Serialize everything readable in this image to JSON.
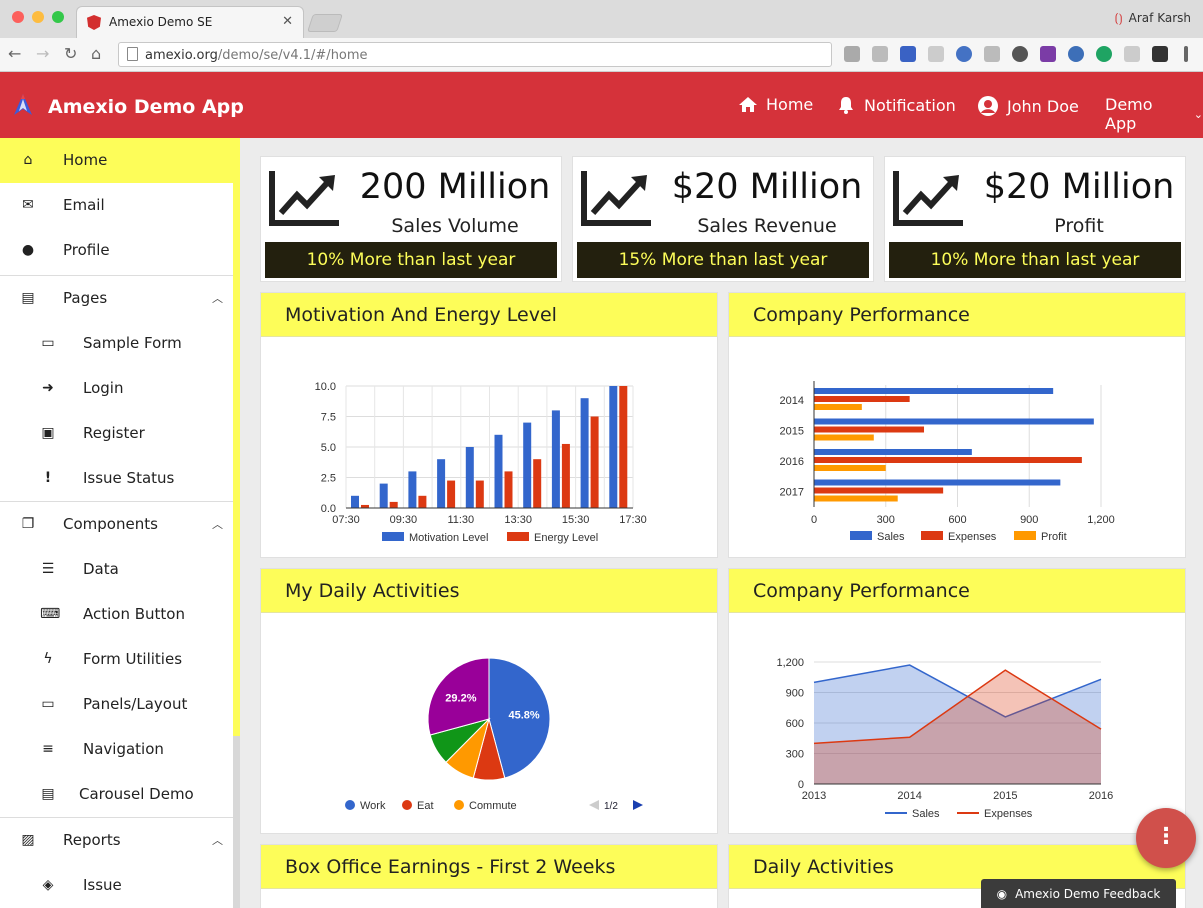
{
  "browser": {
    "tab_title": "Amexio Demo SE",
    "url_host": "amexio.org",
    "url_path": "/demo/se/v4.1/#/home",
    "user_name": "Araf Karsh"
  },
  "header": {
    "app_title": "Amexio Demo App",
    "nav": [
      {
        "label": "Home",
        "icon": "home-icon"
      },
      {
        "label": "Notification",
        "icon": "bell-icon"
      },
      {
        "label": "John Doe",
        "icon": "user-circle-icon"
      },
      {
        "label": "Demo App",
        "icon": "chevron-down-icon"
      }
    ]
  },
  "sidebar": {
    "items": [
      {
        "label": "Home",
        "icon": "home-icon",
        "active": true
      },
      {
        "label": "Email",
        "icon": "envelope-icon"
      },
      {
        "label": "Profile",
        "icon": "user-icon"
      },
      {
        "label": "Pages",
        "icon": "id-card-icon",
        "expanded": true
      },
      {
        "label": "Sample Form",
        "icon": "laptop-icon"
      },
      {
        "label": "Login",
        "icon": "sign-in-icon"
      },
      {
        "label": "Register",
        "icon": "address-book-icon"
      },
      {
        "label": "Issue Status",
        "icon": "exclamation-icon"
      },
      {
        "label": "Components",
        "icon": "clone-icon",
        "expanded": true
      },
      {
        "label": "Data",
        "icon": "database-icon"
      },
      {
        "label": "Action Button",
        "icon": "keyboard-icon"
      },
      {
        "label": "Form Utilities",
        "icon": "bolt-icon"
      },
      {
        "label": "Panels/Layout",
        "icon": "desktop-icon"
      },
      {
        "label": "Navigation",
        "icon": "bars-icon"
      },
      {
        "label": "Carousel Demo",
        "icon": "list-alt-icon"
      },
      {
        "label": "Reports",
        "icon": "image-icon",
        "expanded": true
      },
      {
        "label": "Issue",
        "icon": "ticket-icon"
      }
    ]
  },
  "kpis": [
    {
      "value": "200 Million",
      "label": "Sales Volume",
      "note": "10% More than last year"
    },
    {
      "value": "$20 Million",
      "label": "Sales Revenue",
      "note": "15% More than last year"
    },
    {
      "value": "$20 Million",
      "label": "Profit",
      "note": "10% More than last year"
    }
  ],
  "panels": {
    "p1": "Motivation And Energy Level",
    "p2": "Company Performance",
    "p3": "My Daily Activities",
    "p4": "Company Performance",
    "p5": "Box Office Earnings - First 2 Weeks",
    "p6": "Daily Activities"
  },
  "fab_label": "⋮",
  "feedback_label": "Amexio Demo Feedback",
  "colors": {
    "brand": "#d5323a",
    "accent": "#fdfd59",
    "blue": "#3366cc",
    "red": "#dc3912",
    "orange": "#ff9900",
    "green": "#109618",
    "purple": "#990099"
  },
  "chart_data": [
    {
      "type": "bar",
      "title": "",
      "x": [
        "07:30",
        "08:30",
        "09:30",
        "10:30",
        "11:30",
        "12:30",
        "13:30",
        "14:30",
        "15:30",
        "16:30",
        "17:30"
      ],
      "xticks": [
        "07:30",
        "09:30",
        "11:30",
        "13:30",
        "15:30",
        "17:30"
      ],
      "yticks": [
        "0.0",
        "2.5",
        "5.0",
        "7.5",
        "10.0"
      ],
      "ylim": [
        0,
        10
      ],
      "series": [
        {
          "name": "Motivation Level",
          "color": "#3366cc",
          "values": [
            1,
            2,
            3,
            4,
            5,
            6,
            7,
            8,
            9,
            10,
            0
          ]
        },
        {
          "name": "Energy Level",
          "color": "#dc3912",
          "values": [
            0.25,
            0.5,
            1,
            2.25,
            2.25,
            3,
            4,
            5.25,
            7.5,
            10,
            0
          ]
        }
      ]
    },
    {
      "type": "bar",
      "orientation": "horizontal",
      "categories": [
        "2014",
        "2015",
        "2016",
        "2017"
      ],
      "xticks": [
        "0",
        "300",
        "600",
        "900",
        "1,200"
      ],
      "xlim": [
        0,
        1200
      ],
      "series": [
        {
          "name": "Sales",
          "color": "#3366cc",
          "values": [
            1000,
            1170,
            660,
            1030
          ]
        },
        {
          "name": "Expenses",
          "color": "#dc3912",
          "values": [
            400,
            460,
            1120,
            540
          ]
        },
        {
          "name": "Profit",
          "color": "#ff9900",
          "values": [
            200,
            250,
            300,
            350
          ]
        }
      ]
    },
    {
      "type": "pie",
      "slices": [
        {
          "name": "Work",
          "value": 45.8,
          "color": "#3366cc",
          "label": "45.8%"
        },
        {
          "name": "Eat",
          "value": 8.3,
          "color": "#dc3912"
        },
        {
          "name": "Commute",
          "value": 8.3,
          "color": "#ff9900"
        },
        {
          "name": "",
          "value": 8.3,
          "color": "#109618"
        },
        {
          "name": "",
          "value": 29.2,
          "color": "#990099",
          "label": "29.2%"
        }
      ],
      "legend_visible": [
        "Work",
        "Eat",
        "Commute"
      ],
      "legend_page": "1/2"
    },
    {
      "type": "area",
      "x": [
        "2013",
        "2014",
        "2015",
        "2016"
      ],
      "yticks": [
        "0",
        "300",
        "600",
        "900",
        "1,200"
      ],
      "ylim": [
        0,
        1200
      ],
      "series": [
        {
          "name": "Sales",
          "color": "#3366cc",
          "values": [
            1000,
            1170,
            660,
            1030
          ]
        },
        {
          "name": "Expenses",
          "color": "#dc3912",
          "values": [
            400,
            460,
            1120,
            540
          ]
        }
      ]
    }
  ]
}
